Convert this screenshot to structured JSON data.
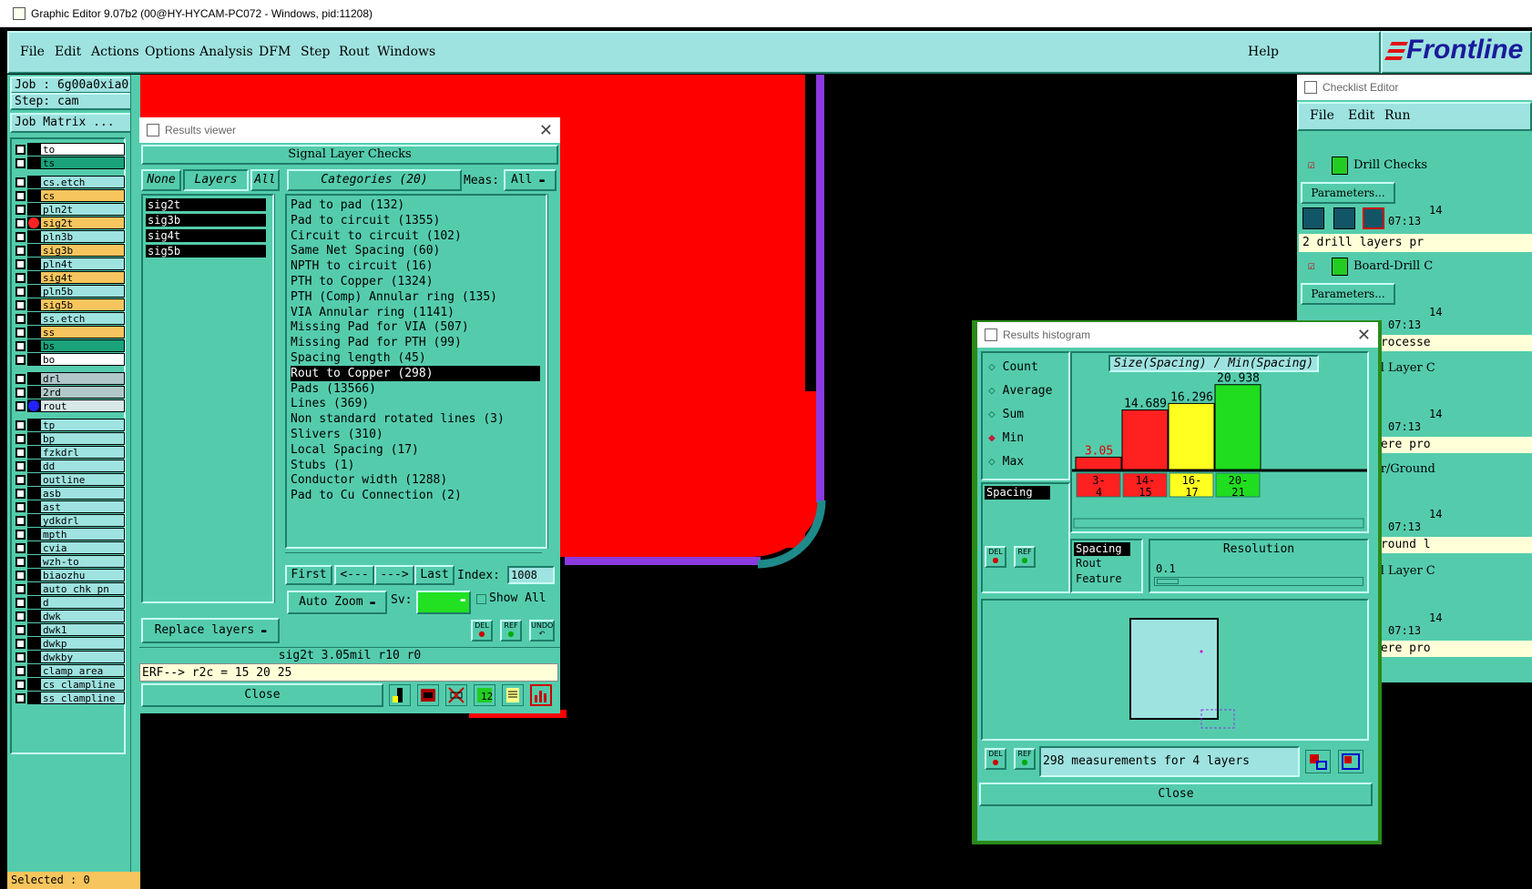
{
  "window": {
    "title": "Graphic Editor 9.07b2 (00@HY-HYCAM-PC072 - Windows, pid:11208)"
  },
  "menu": {
    "items": [
      "File",
      "Edit",
      "Actions",
      "Options",
      "Analysis",
      "DFM",
      "Step",
      "Rout",
      "Windows"
    ],
    "help": "Help"
  },
  "logo": {
    "text": "Frontline"
  },
  "job": {
    "job": "Job : 6g00a0xia0",
    "step": "Step: cam",
    "matrix": "Job Matrix ..."
  },
  "layers": [
    {
      "name": "to",
      "color": "#ffffff"
    },
    {
      "name": "ts",
      "color": "#1aa37a"
    },
    {
      "name": "cs.etch",
      "color": "#9ee3e0"
    },
    {
      "name": "cs",
      "color": "#f7c55d"
    },
    {
      "name": "pln2t",
      "color": "#9ee3e0"
    },
    {
      "name": "sig2t",
      "color": "#f7c55d"
    },
    {
      "name": "pln3b",
      "color": "#9ee3e0"
    },
    {
      "name": "sig3b",
      "color": "#f7c55d"
    },
    {
      "name": "pln4t",
      "color": "#9ee3e0"
    },
    {
      "name": "sig4t",
      "color": "#f7c55d"
    },
    {
      "name": "pln5b",
      "color": "#9ee3e0"
    },
    {
      "name": "sig5b",
      "color": "#f7c55d"
    },
    {
      "name": "ss.etch",
      "color": "#9ee3e0"
    },
    {
      "name": "ss",
      "color": "#f7c55d"
    },
    {
      "name": "bs",
      "color": "#1aa37a"
    },
    {
      "name": "bo",
      "color": "#ffffff"
    },
    {
      "name": "drl",
      "color": "#b0c8c8"
    },
    {
      "name": "2rd",
      "color": "#b0c8c8"
    },
    {
      "name": "rout",
      "color": "#d8e8e8"
    },
    {
      "name": "tp",
      "color": "#9ee3e0"
    },
    {
      "name": "bp",
      "color": "#9ee3e0"
    },
    {
      "name": "fzkdrl",
      "color": "#9ee3e0"
    },
    {
      "name": "dd",
      "color": "#9ee3e0"
    },
    {
      "name": "outline",
      "color": "#9ee3e0"
    },
    {
      "name": "asb",
      "color": "#9ee3e0"
    },
    {
      "name": "ast",
      "color": "#9ee3e0"
    },
    {
      "name": "ydkdrl",
      "color": "#9ee3e0"
    },
    {
      "name": "mpth",
      "color": "#9ee3e0"
    },
    {
      "name": "cvia",
      "color": "#9ee3e0"
    },
    {
      "name": "wzh-to",
      "color": "#9ee3e0"
    },
    {
      "name": "biaozhu",
      "color": "#9ee3e0"
    },
    {
      "name": "auto_chk_pn",
      "color": "#9ee3e0"
    },
    {
      "name": "d",
      "color": "#9ee3e0"
    },
    {
      "name": "dwk",
      "color": "#9ee3e0"
    },
    {
      "name": "dwk1",
      "color": "#9ee3e0"
    },
    {
      "name": "dwkp",
      "color": "#9ee3e0"
    },
    {
      "name": "dwkby",
      "color": "#9ee3e0"
    },
    {
      "name": "clamp_area",
      "color": "#9ee3e0"
    },
    {
      "name": "cs_clampline",
      "color": "#9ee3e0"
    },
    {
      "name": "ss_clampline",
      "color": "#9ee3e0"
    }
  ],
  "selected": "Selected : 0",
  "results_viewer": {
    "title": "Results viewer",
    "header": "Signal Layer Checks",
    "none": "None",
    "layers_btn": "Layers",
    "all": "All",
    "categories_btn": "Categories (20)",
    "meas_label": "Meas:",
    "meas_value": "All",
    "layer_items": [
      "sig2t",
      "sig3b",
      "sig4t",
      "sig5b"
    ],
    "categories": [
      "Pad to pad (132)",
      "Pad to circuit (1355)",
      "Circuit to circuit (102)",
      "Same Net Spacing (60)",
      "NPTH to circuit (16)",
      "PTH to Copper (1324)",
      "PTH (Comp) Annular ring (135)",
      "VIA Annular ring (1141)",
      "Missing Pad for VIA (507)",
      "Missing Pad for PTH (99)",
      "Spacing length (45)",
      "Rout to Copper (298)",
      "Pads (13566)",
      "Lines (369)",
      "Non standard rotated lines (3)",
      "Slivers (310)",
      "Local Spacing (17)",
      "Stubs (1)",
      "Conductor width (1288)",
      "Pad to Cu Connection (2)"
    ],
    "selected_category": 11,
    "first": "First",
    "prev": "<---",
    "next": "--->",
    "last": "Last",
    "index_label": "Index:",
    "index_value": "1008",
    "autozoom": "Auto Zoom",
    "sv": "Sv:",
    "show_all": "Show All",
    "replace": "Replace layers",
    "del": "DEL",
    "ref": "REF",
    "undo": "UNDO",
    "status": "sig2t  3.05mil  r10  r0",
    "erf": "ERF--> r2c = 15 20 25",
    "close": "Close"
  },
  "histogram": {
    "title": "Results histogram",
    "options": [
      "Count",
      "Average",
      "Sum",
      "Min",
      "Max"
    ],
    "selected_option": "Min",
    "chart_title": "Size(Spacing) / Min(Spacing)",
    "list_item": "Spacing",
    "del": "DEL",
    "ref": "REF",
    "bars": [
      {
        "label": "3-4",
        "value": 3.05,
        "value_text": "3.05",
        "color": "#ff2020"
      },
      {
        "label": "14-15",
        "value": 14.689,
        "value_text": "14.689",
        "color": "#ff2020"
      },
      {
        "label": "16-17",
        "value": 16.296,
        "value_text": "16.296",
        "color": "#ffff20"
      },
      {
        "label": "20-21",
        "value": 20.938,
        "value_text": "20.938",
        "color": "#20dd20"
      }
    ],
    "attributes": [
      "Spacing",
      "Rout",
      "Feature"
    ],
    "resolution_label": "Resolution",
    "resolution_value": "0.1",
    "measurements": "298 measurements for 4 layers",
    "close": "Close"
  },
  "checklist": {
    "title": "Checklist Editor",
    "menu": [
      "File",
      "Edit",
      "Run"
    ],
    "check1": "Drill Checks",
    "params": "Parameters...",
    "time1": "14",
    "time2": "07:13",
    "info1": "2 drill layers pr",
    "check2": "Board-Drill C",
    "frag": [
      "processe",
      "al Layer C",
      "were pro",
      "er/Ground",
      "ground l",
      "al Layer C",
      "were pro"
    ]
  }
}
